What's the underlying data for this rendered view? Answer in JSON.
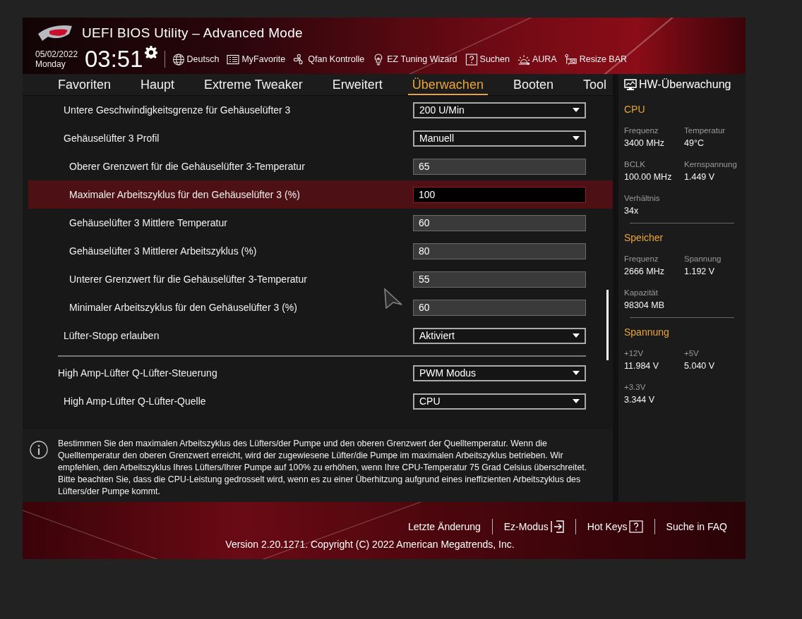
{
  "window": {
    "title": "UEFI BIOS Utility – Advanced Mode"
  },
  "clock": {
    "date": "05/02/2022",
    "day": "Monday",
    "time": "03:51"
  },
  "toolbar": [
    {
      "label": "Deutsch",
      "kind": "globe"
    },
    {
      "label": "MyFavorite",
      "kind": "favorite"
    },
    {
      "label": "Qfan Kontrolle",
      "kind": "fan"
    },
    {
      "label": "EZ Tuning Wizard",
      "kind": "bulb"
    },
    {
      "label": "Suchen",
      "kind": "help"
    },
    {
      "label": "AURA",
      "kind": "aura"
    },
    {
      "label": "Resize BAR",
      "kind": "card"
    }
  ],
  "tabs": [
    {
      "label": "Favoriten",
      "selected": false
    },
    {
      "label": "Haupt",
      "selected": false
    },
    {
      "label": "Extreme Tweaker",
      "selected": false
    },
    {
      "label": "Erweitert",
      "selected": false
    },
    {
      "label": "Überwachen",
      "selected": true
    },
    {
      "label": "Booten",
      "selected": false
    },
    {
      "label": "Tool",
      "selected": false
    }
  ],
  "settings": [
    {
      "rows": [
        {
          "label": "Untere Geschwindigkeitsgrenze für Gehäuselüfter 3",
          "kind": "dropdown",
          "value": "200 U/Min",
          "selected": false
        },
        {
          "label": "Gehäuselüfter 3 Profil",
          "kind": "dropdown",
          "value": "Manuell",
          "selected": false,
          "children": [
            {
              "label": "Oberer Grenzwert für die Gehäuselüfter 3-Temperatur",
              "kind": "number",
              "value": "65",
              "selected": false
            },
            {
              "label": "Maximaler Arbeitszyklus für den Gehäuselüfter 3 (%)",
              "kind": "number",
              "value": "100",
              "selected": true
            },
            {
              "label": "Gehäuselüfter 3 Mittlere Temperatur",
              "kind": "number",
              "value": "60",
              "selected": false
            },
            {
              "label": "Gehäuselüfter 3 Mittlerer Arbeitszyklus (%)",
              "kind": "number",
              "value": "80",
              "selected": false
            },
            {
              "label": "Unterer Grenzwert für die Gehäuselüfter 3-Temperatur",
              "kind": "number",
              "value": "55",
              "selected": false
            },
            {
              "label": "Minimaler Arbeitszyklus für den Gehäuselüfter 3 (%)",
              "kind": "number",
              "value": "60",
              "selected": false
            }
          ]
        },
        {
          "label": "Lüfter-Stopp erlauben",
          "kind": "dropdown",
          "value": "Aktiviert",
          "selected": false
        }
      ]
    },
    {
      "rows": [
        {
          "label": "High Amp-Lüfter Q-Lüfter-Steuerung",
          "kind": "dropdown",
          "value": "PWM Modus",
          "selected": false,
          "children": [
            {
              "label": "High Amp-Lüfter Q-Lüfter-Quelle",
              "kind": "dropdown",
              "value": "CPU",
              "selected": false
            }
          ]
        }
      ]
    }
  ],
  "help_text": "Bestimmen Sie den maximalen Arbeitszyklus des Lüfters/der Pumpe und den oberen Grenzwert der Quelltemperatur. Wenn die Quelltemperatur den oberen Grenzwert erreicht, wird der zugewiesene Lüfter/die Pumpe im maximalen Arbeitszyklus betrieben. Wir empfehlen, den Arbeitszyklus Ihres Lüfters/Ihrer Pumpe auf 100% zu erhöhen, wenn Ihre CPU-Temperatur 75 Grad Celsius überschreitet. Bitte beachten Sie, dass die CPU-Leistung gedrosselt wird, wenn es zu einer Überhitzung aufgrund eines ineffizienten Arbeitszyklus des Lüfters/der Pumpe kommt.",
  "hw_monitor": {
    "title": "HW-Überwachung",
    "sections": [
      {
        "heading": "CPU",
        "items": [
          {
            "label": "Frequenz",
            "value": "3400 MHz"
          },
          {
            "label": "Temperatur",
            "value": "49°C"
          },
          {
            "label": "BCLK",
            "value": "100.00 MHz"
          },
          {
            "label": "Kernspannung",
            "value": "1.449 V"
          },
          {
            "label": "Verhältnis",
            "value": "34x"
          }
        ]
      },
      {
        "heading": "Speicher",
        "items": [
          {
            "label": "Frequenz",
            "value": "2666 MHz"
          },
          {
            "label": "Spannung",
            "value": "1.192 V"
          },
          {
            "label": "Kapazität",
            "value": "98304 MB"
          }
        ]
      },
      {
        "heading": "Spannung",
        "items": [
          {
            "label": "+12V",
            "value": "11.984 V"
          },
          {
            "label": "+5V",
            "value": "5.040 V"
          },
          {
            "label": "+3.3V",
            "value": "3.344 V"
          }
        ]
      }
    ]
  },
  "footer": {
    "links": [
      {
        "label": "Letzte Änderung",
        "kind": "plain"
      },
      {
        "label": "Ez-Modus",
        "kind": "exit"
      },
      {
        "label": "Hot Keys",
        "kind": "help"
      },
      {
        "label": "Suche in FAQ",
        "kind": "plain"
      }
    ],
    "version": "Version 2.20.1271. Copyright (C) 2022 American Megatrends, Inc."
  }
}
